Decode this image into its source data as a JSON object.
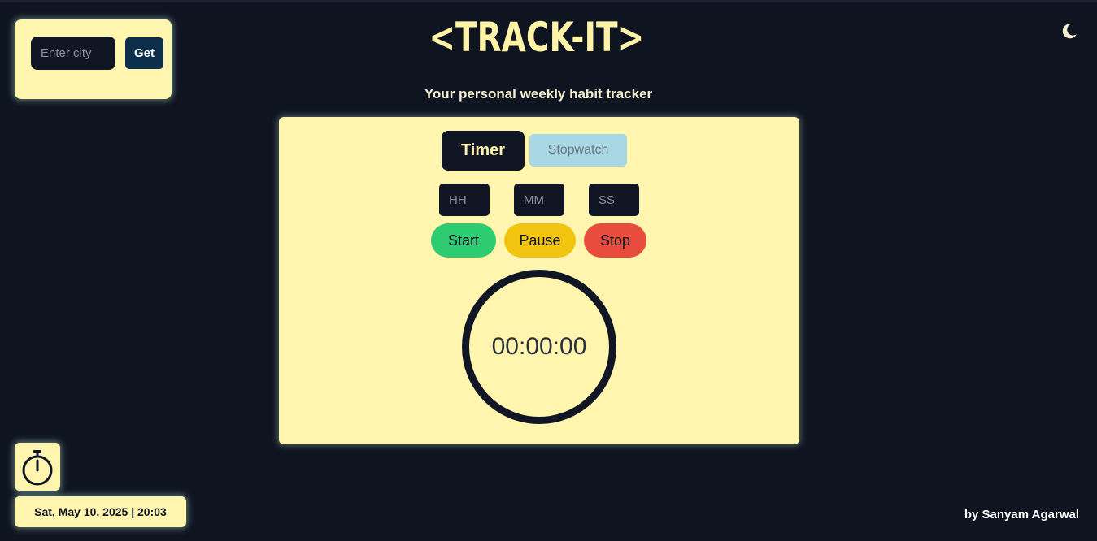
{
  "header": {
    "logo": "<TRACK-IT>",
    "subtitle": "Your personal weekly habit tracker",
    "theme_icon": "moon-icon"
  },
  "weather": {
    "city_placeholder": "Enter city",
    "city_value": "",
    "get_label": "Get"
  },
  "timer_panel": {
    "tabs": [
      {
        "label": "Timer",
        "active": true
      },
      {
        "label": "Stopwatch",
        "active": false
      }
    ],
    "inputs": {
      "hh_placeholder": "HH",
      "mm_placeholder": "MM",
      "ss_placeholder": "SS"
    },
    "buttons": {
      "start": "Start",
      "pause": "Pause",
      "stop": "Stop"
    },
    "display": "00:00:00"
  },
  "sidebar": {
    "stopwatch_icon": "stopwatch-icon"
  },
  "footer": {
    "datetime": "Sat, May 10, 2025 | 20:03",
    "credit": "by Sanyam Agarwal"
  },
  "colors": {
    "background": "#0f1421",
    "card": "#fff5ae",
    "dark": "#111624",
    "start": "#2ecc71",
    "pause": "#f1c40f",
    "stop": "#e74c3c",
    "stopwatch_tab": "#a8d7e5",
    "get_button": "#0b2f4a"
  }
}
